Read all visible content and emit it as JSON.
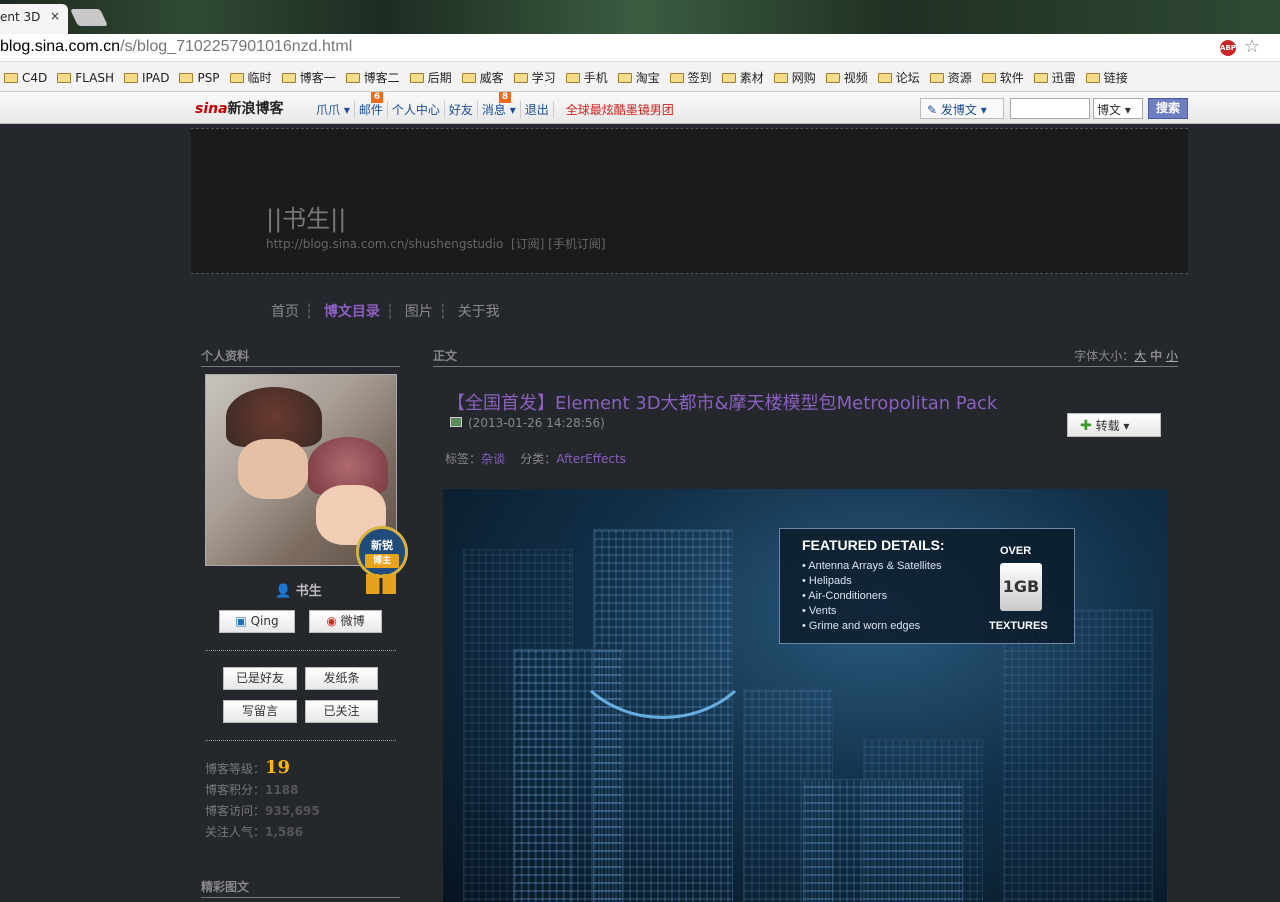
{
  "browser": {
    "tab_title": "ent 3D",
    "tab_close": "×",
    "url_host": "blog.sina.com.cn",
    "url_path": "/s/blog_7102257901016nzd.html",
    "abp": "ABP",
    "star": "☆"
  },
  "bookmarks": [
    "C4D",
    "FLASH",
    "IPAD",
    "PSP",
    "临时",
    "博客一",
    "博客二",
    "后期",
    "威客",
    "学习",
    "手机",
    "淘宝",
    "签到",
    "素材",
    "网购",
    "视频",
    "论坛",
    "资源",
    "软件",
    "迅雷",
    "链接"
  ],
  "sina_bar": {
    "logo_s": "sina",
    "logo_text": "新浪博客",
    "links": [
      {
        "label": "爪爪 ▾",
        "badge": ""
      },
      {
        "label": "邮件",
        "badge": "6"
      },
      {
        "label": "个人中心",
        "badge": ""
      },
      {
        "label": "好友",
        "badge": ""
      },
      {
        "label": "消息 ▾",
        "badge": "8"
      },
      {
        "label": "退出",
        "badge": ""
      }
    ],
    "promo": "全球最炫酷墨镜男团",
    "post_label": "发博文 ▾",
    "search_placeholder": "",
    "search_type": "博文 ▾",
    "search_button": "搜索"
  },
  "header": {
    "title": "||书生||",
    "url": "http://blog.sina.com.cn/shushengstudio",
    "subscribe": "[订阅]",
    "mobile_subscribe": "[手机订阅]"
  },
  "menu": [
    "首页",
    "博文目录",
    "图片",
    "关于我"
  ],
  "sidebar": {
    "profile_heading": "个人资料",
    "username": "书生",
    "medal_top": "新锐",
    "medal_bottom": "博主",
    "qing_label": "Qing",
    "weibo_label": "微博",
    "btn_friend": "已是好友",
    "btn_note": "发纸条",
    "btn_message": "写留言",
    "btn_follow": "已关注",
    "stats": {
      "level_label": "博客等级：",
      "level": "19",
      "points_label": "博客积分：",
      "points": "1188",
      "visits_label": "博客访问：",
      "visits": "935,695",
      "popularity_label": "关注人气：",
      "popularity": "1,586"
    },
    "featured_heading": "精彩图文"
  },
  "main": {
    "heading": "正文",
    "font_size_label": "字体大小：",
    "font_large": "大",
    "font_medium": "中",
    "font_small": "小",
    "post_title": "【全国首发】Element 3D大都市&摩天楼模型包Metropolitan Pack",
    "post_date": "(2013-01-26 14:28:56)",
    "reprint_label": "转载 ▾",
    "tags_label": "标签：",
    "tag_value": "杂谈",
    "category_label": "分类：",
    "category_value": "AfterEffects",
    "image": {
      "featured_title": "FEATURED DETAILS:",
      "features": [
        "• Antenna Arrays & Satellites",
        "• Helipads",
        "• Air-Conditioners",
        "• Vents",
        "• Grime and worn edges"
      ],
      "over": "OVER",
      "size": "1GB",
      "textures": "TEXTURES"
    }
  },
  "colors": {
    "accent_purple": "#8a5fbe",
    "link_blue": "#1b4e9a",
    "level_gold": "#ffb400",
    "page_bg": "#24272c"
  }
}
